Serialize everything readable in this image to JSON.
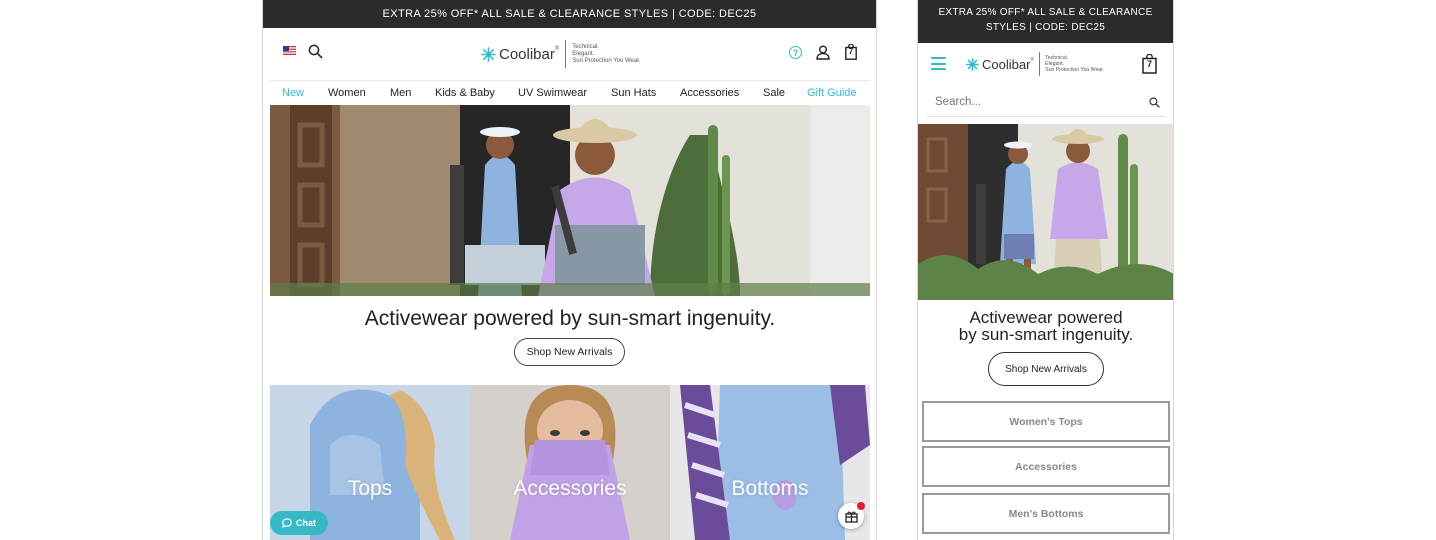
{
  "colors": {
    "accent": "#36b8c7",
    "promo_bg": "#2b2b2b",
    "chat_bg": "#36b8c7",
    "badge": "#d6213a"
  },
  "desktop": {
    "promo": "EXTRA 25% OFF* ALL SALE & CLEARANCE STYLES | CODE: DEC25",
    "logo": {
      "wordmark": "Coolibar",
      "reg": "®",
      "tagline": [
        "Technical.",
        "Elegant.",
        "Sun Protection You Wear."
      ]
    },
    "help_label": "?",
    "cart_count": "7",
    "nav": [
      {
        "label": "New"
      },
      {
        "label": "Women"
      },
      {
        "label": "Men"
      },
      {
        "label": "Kids & Baby"
      },
      {
        "label": "UV Swimwear"
      },
      {
        "label": "Sun Hats"
      },
      {
        "label": "Accessories"
      },
      {
        "label": "Sale"
      },
      {
        "label": "Gift Guide"
      }
    ],
    "hero": {
      "headline": "Activewear powered by sun-smart ingenuity.",
      "cta": "Shop New Arrivals"
    },
    "categories": [
      {
        "label": "Tops"
      },
      {
        "label": "Accessories"
      },
      {
        "label": "Bottoms"
      }
    ],
    "chat_label": "Chat"
  },
  "mobile": {
    "promo": "EXTRA 25% OFF* ALL SALE & CLEARANCE STYLES | CODE: DEC25",
    "logo": {
      "wordmark": "Coolibar",
      "reg": "®",
      "tagline": [
        "Technical.",
        "Elegant.",
        "Sun Protection You Wear."
      ]
    },
    "cart_count": "7",
    "search_placeholder": "Search...",
    "hero": {
      "headline": [
        "Activewear powered",
        "by sun-smart ingenuity."
      ],
      "cta": "Shop New Arrivals"
    },
    "buttons": [
      {
        "label": "Women's Tops"
      },
      {
        "label": "Accessories"
      },
      {
        "label": "Men's Bottoms"
      }
    ]
  }
}
